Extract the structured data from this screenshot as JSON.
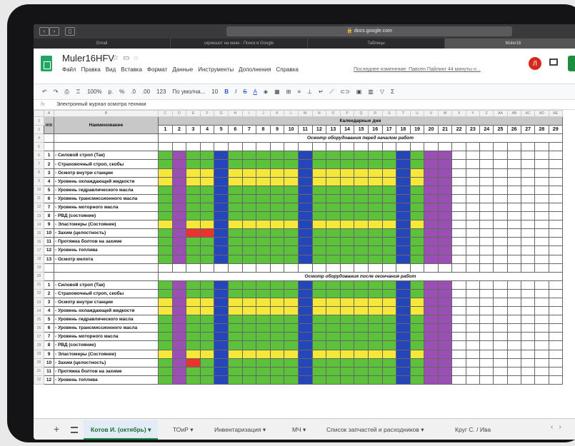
{
  "browser": {
    "address": "docs.google.com",
    "tabs": [
      "Gmail",
      "скриншот на маке - Поиск в Google",
      "Таблицы",
      "Muler16"
    ],
    "active_tab": 3
  },
  "sheet": {
    "title": "Muler16HFV",
    "menu": [
      "Файл",
      "Правка",
      "Вид",
      "Вставка",
      "Формат",
      "Данные",
      "Инструменты",
      "Дополнения",
      "Справка"
    ],
    "last_edit": "Последнее изменение: Павсен Пайлинг 44 минуты н...",
    "avatar_letter": "Л",
    "toolbar": {
      "zoom": "100%",
      "currency": "р.",
      "percent": "%",
      "dec0": ".0",
      "dec00": ".00",
      "format123": "123",
      "font": "По умолча...",
      "font_size": "10",
      "bold": "B",
      "italic": "I",
      "strike": "S",
      "underline": "A"
    },
    "formula": "Электронный журнал осмотра техники",
    "col_headers": [
      "",
      "A",
      "B",
      "C",
      "D",
      "E",
      "F",
      "G",
      "H",
      "I",
      "J",
      "K",
      "L",
      "M",
      "N",
      "O",
      "P",
      "Q",
      "R",
      "S",
      "T",
      "U",
      "V",
      "W",
      "X",
      "Y",
      "Z",
      "AA",
      "AB",
      "AC",
      "AD",
      "AE"
    ],
    "header_rows": {
      "np": "п/п",
      "name": "Наименование",
      "calendar": "Календарные дни",
      "days": [
        "1",
        "2",
        "3",
        "4",
        "5",
        "6",
        "7",
        "8",
        "9",
        "10",
        "11",
        "12",
        "13",
        "14",
        "15",
        "16",
        "17",
        "18",
        "19",
        "20",
        "21",
        "22",
        "23",
        "24",
        "25",
        "26",
        "27",
        "28",
        "29"
      ]
    },
    "section_before": "Осмотр оборудования перед началом работ",
    "section_after": "Осмотр оборудования после окончания работ",
    "rows_before": [
      {
        "n": "1",
        "name": "- Силовой строп (Так)"
      },
      {
        "n": "2",
        "name": "- Страховочный строп, скобы"
      },
      {
        "n": "3",
        "name": "- Осмотр внутри станции"
      },
      {
        "n": "4",
        "name": "- Уровень охлаждающей жидкости"
      },
      {
        "n": "5",
        "name": "- Уровень гидравлического масла"
      },
      {
        "n": "6",
        "name": "- Уровень трансмиссионного масла"
      },
      {
        "n": "7",
        "name": "- Уровень моторного масла"
      },
      {
        "n": "8",
        "name": "- РВД (состояние)"
      },
      {
        "n": "9",
        "name": "- Эластомеры (Состояние)"
      },
      {
        "n": "10",
        "name": "- Захим (целостность)"
      },
      {
        "n": "11",
        "name": "- Протяжка болтов на захиме"
      },
      {
        "n": "12",
        "name": "- Уровень топлива"
      },
      {
        "n": "13",
        "name": "- Осмотр мелота"
      }
    ],
    "rows_after": [
      {
        "n": "1",
        "name": "- Силовой строп (Так)"
      },
      {
        "n": "2",
        "name": "- Страховочный строп, скобы"
      },
      {
        "n": "3",
        "name": "- Осмотр внутри станции"
      },
      {
        "n": "4",
        "name": "- Уровень охлаждающей жидкости"
      },
      {
        "n": "5",
        "name": "- Уровень гидравлического масла"
      },
      {
        "n": "6",
        "name": "- Уровень трансмиссионного масла"
      },
      {
        "n": "7",
        "name": "- Уровень моторного масла"
      },
      {
        "n": "8",
        "name": "- РВД (состояние)"
      },
      {
        "n": "9",
        "name": "- Эластомеры (Состояние)"
      },
      {
        "n": "10",
        "name": "- Захим (целостность)"
      },
      {
        "n": "11",
        "name": "- Протяжка болтов на захиме"
      },
      {
        "n": "12",
        "name": "- Уровень топлива"
      }
    ],
    "tabs": [
      "Котов И. (октябрь)",
      "ТОиР",
      "Инвентаризация",
      "МЧ",
      "Список запчастей и расходников",
      "Круг С. / Ива"
    ]
  },
  "colors": {
    "green": "#5cc23c",
    "yellow": "#f5e83a",
    "blue": "#2446b8",
    "purple": "#9b4fb4",
    "red": "#e8342a"
  },
  "day_colors": {
    "purple_days": [
      2,
      20,
      21
    ],
    "blue_days": [
      5,
      11,
      18
    ],
    "filled_through": 21,
    "yellow_rows_before": [
      3,
      4,
      9
    ],
    "yellow_rows_after": [
      3,
      4,
      9
    ],
    "red_cells_before": [
      {
        "row": 10,
        "days": [
          3,
          4
        ]
      }
    ],
    "red_cells_after": [
      {
        "row": 10,
        "days": [
          3
        ]
      }
    ]
  }
}
